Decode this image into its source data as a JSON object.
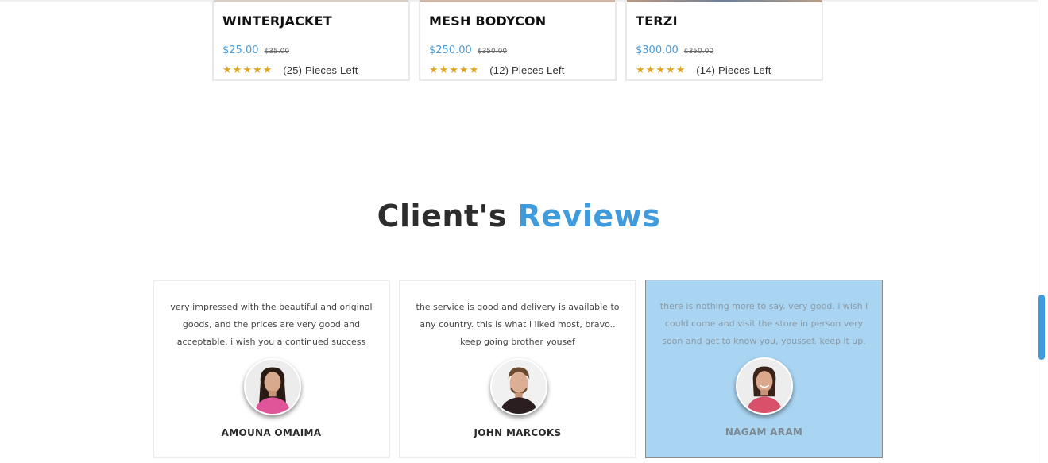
{
  "products": [
    {
      "name": "WINTERJACKET",
      "price": "$25.00",
      "old_price": "$35.00",
      "stock": "(25) Pieces Left"
    },
    {
      "name": "MESH BODYCON",
      "price": "$250.00",
      "old_price": "$350.00",
      "stock": "(12) Pieces Left"
    },
    {
      "name": "TERZI",
      "price": "$300.00",
      "old_price": "$350.00",
      "stock": "(14) Pieces Left"
    }
  ],
  "star_glyph": "★",
  "reviews_section": {
    "title_part1": "Client's",
    "title_part2": "Reviews",
    "accent_color": "#3f9bdc"
  },
  "reviews": [
    {
      "text": "very impressed with the beautiful and original goods, and the prices are very good and acceptable. i wish you a continued success",
      "name": "AMOUNA OMAIMA",
      "avatar": "woman-avatar"
    },
    {
      "text": "the service is good and delivery is available to any country. this is what i liked most, bravo.. keep going brother yousef",
      "name": "JOHN MARCOKS",
      "avatar": "man-avatar"
    },
    {
      "text": "there is nothing more to say. very good. i wish i could come and visit the store in person very soon and get to know you, youssef. keep it up.",
      "name": "NAGAM ARAM",
      "avatar": "woman-avatar"
    }
  ]
}
